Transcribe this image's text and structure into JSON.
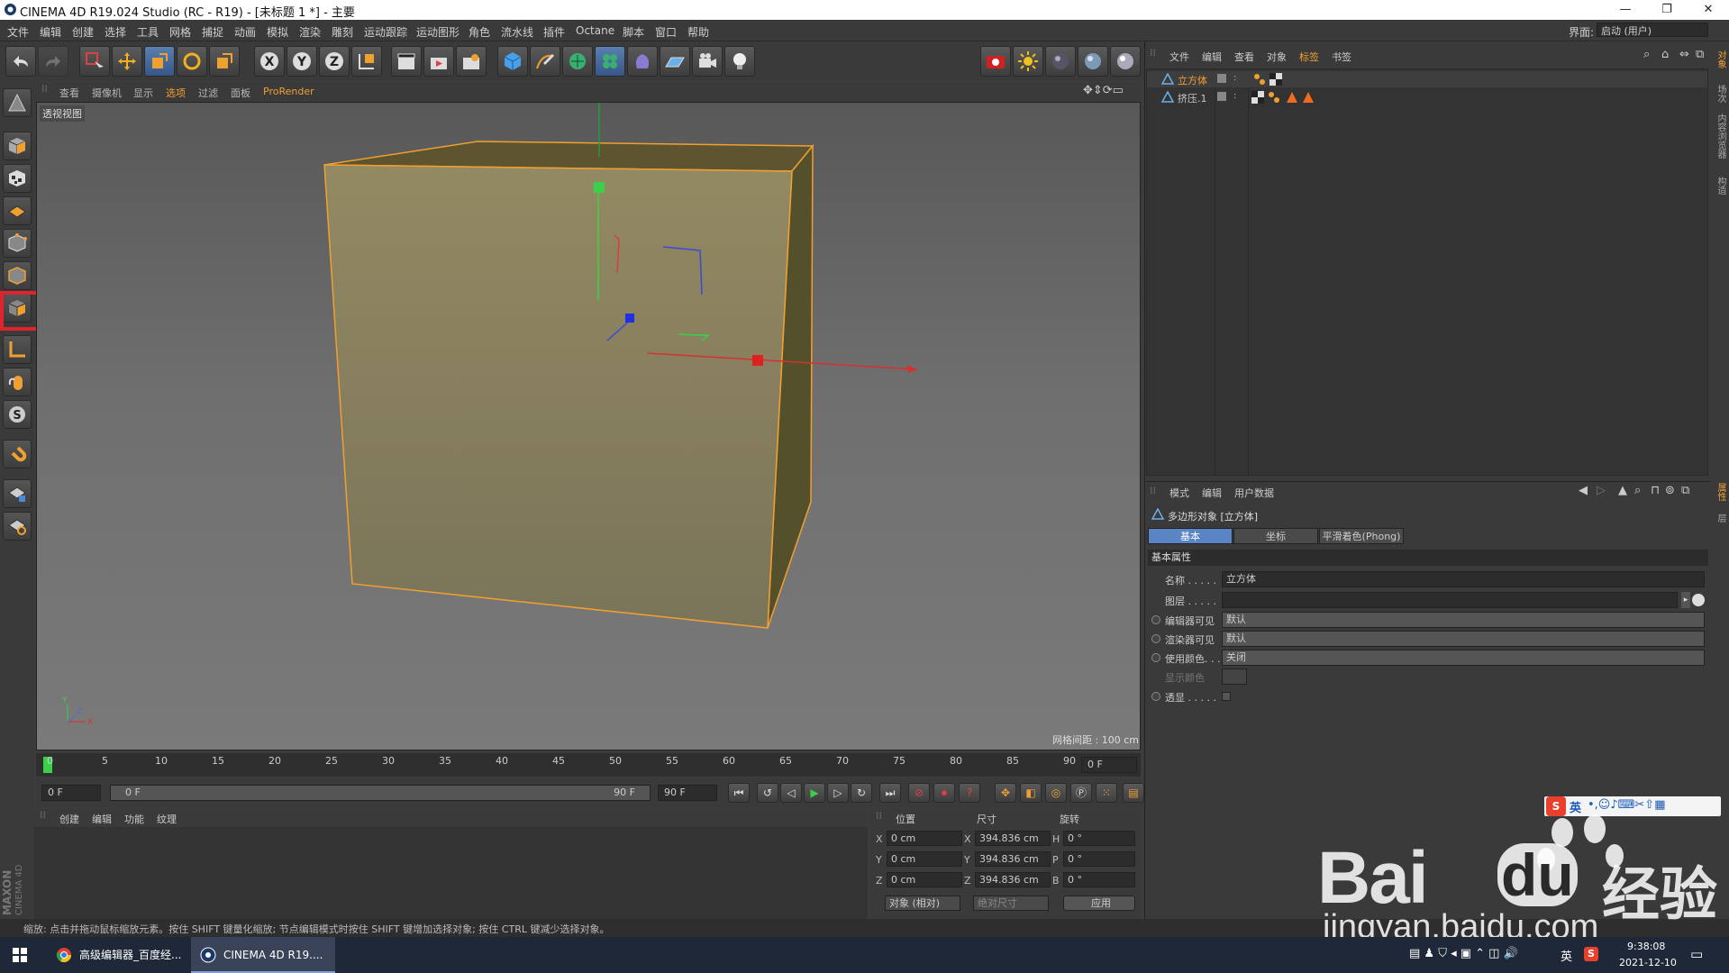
{
  "titlebar": {
    "title": "CINEMA 4D R19.024 Studio (RC - R19) - [未标题 1 *] - 主要",
    "minimize": "—",
    "restore": "❐",
    "close": "✕"
  },
  "menubar": {
    "items": [
      "文件",
      "编辑",
      "创建",
      "选择",
      "工具",
      "网格",
      "捕捉",
      "动画",
      "模拟",
      "渲染",
      "雕刻",
      "运动跟踪",
      "运动图形",
      "角色",
      "流水线",
      "插件",
      "Octane",
      "脚本",
      "窗口",
      "帮助"
    ],
    "layout_label": "界面:",
    "layout_value": "启动 (用户)"
  },
  "viewport": {
    "menu": [
      "查看",
      "摄像机",
      "显示",
      "选项",
      "过滤",
      "面板",
      "ProRender"
    ],
    "label": "透视视图",
    "grid_info": "网格间距 : 100 cm"
  },
  "timeline": {
    "ticks": [
      "0",
      "5",
      "10",
      "15",
      "20",
      "25",
      "30",
      "35",
      "40",
      "45",
      "50",
      "55",
      "60",
      "65",
      "70",
      "75",
      "80",
      "85",
      "90"
    ],
    "end_field": "0 F"
  },
  "transport": {
    "start": "0 F",
    "range_start": "0 F",
    "range_end": "90 F",
    "end": "90 F"
  },
  "material": {
    "menu": [
      "创建",
      "编辑",
      "功能",
      "纹理"
    ]
  },
  "coords": {
    "headers": [
      "位置",
      "尺寸",
      "旋转"
    ],
    "axes": [
      "X",
      "Y",
      "Z"
    ],
    "rot_axes": [
      "H",
      "P",
      "B"
    ],
    "pos": [
      "0 cm",
      "0 cm",
      "0 cm"
    ],
    "size": [
      "394.836 cm",
      "394.836 cm",
      "394.836 cm"
    ],
    "rot": [
      "0 °",
      "0 °",
      "0 °"
    ],
    "mode": "对象 (相对)",
    "size_mode": "绝对尺寸",
    "apply": "应用"
  },
  "objects": {
    "menu": [
      "文件",
      "编辑",
      "查看",
      "对象",
      "标签",
      "书签"
    ],
    "rows": [
      {
        "name": "立方体",
        "color": "#f0a030"
      },
      {
        "name": "挤压.1",
        "color": "#c8c8c8"
      }
    ]
  },
  "attributes": {
    "menu": [
      "模式",
      "编辑",
      "用户数据"
    ],
    "title": "多边形对象 [立方体]",
    "tabs": [
      "基本",
      "坐标",
      "平滑着色(Phong)"
    ],
    "section": "基本属性",
    "props": [
      {
        "label": "名称 . . . . .",
        "value": "立方体"
      },
      {
        "label": "图层 . . . . .",
        "value": ""
      },
      {
        "label": "编辑器可见",
        "value": "默认"
      },
      {
        "label": "渲染器可见",
        "value": "默认"
      },
      {
        "label": "使用颜色. . .",
        "value": "关闭"
      },
      {
        "label": "显示颜色",
        "value": ""
      },
      {
        "label": "透显 . . . . .",
        "value": ""
      }
    ]
  },
  "right_vtabs": [
    "对象",
    "场次",
    "内容浏览器",
    "构造",
    "属性",
    "层"
  ],
  "status": {
    "text": "缩放: 点击并拖动鼠标缩放元素。按住 SHIFT 键量化缩放; 节点编辑模式时按住 SHIFT 键增加选择对象; 按住 CTRL 键减少选择对象。"
  },
  "maxon": {
    "line1": "MAXON",
    "line2": "CINEMA 4D"
  },
  "taskbar": {
    "apps": [
      "高级编辑器_百度经...",
      "CINEMA 4D R19...."
    ],
    "ime": "英",
    "time": "9:38:08",
    "date": "2021-12-10"
  },
  "watermark": {
    "brand": "Bai",
    "brand2": "du",
    "cn": "经验",
    "url": "jingyan.baidu.com",
    "ime_text": "英"
  },
  "colors": {
    "accent": "#f0a030",
    "selected_tab": "#5b84c4",
    "highlight": "#e0242d"
  }
}
